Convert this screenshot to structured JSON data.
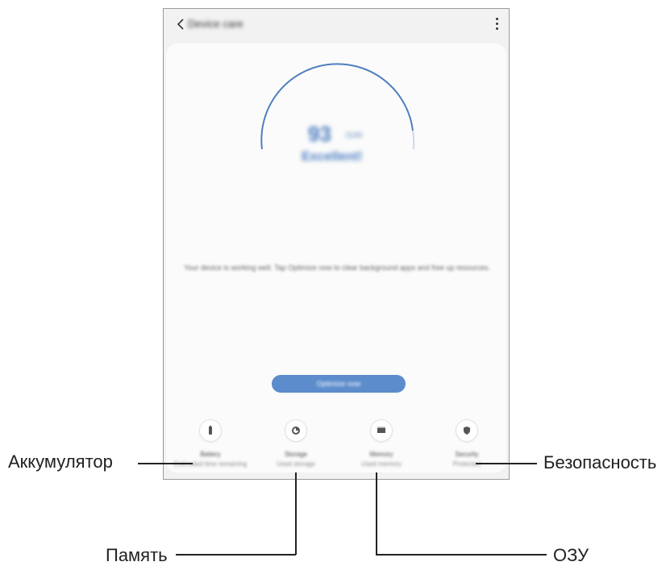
{
  "screen": {
    "title": "Device care",
    "score": "93",
    "score_unit": "/100",
    "status": "Excellent!",
    "description": "Your device is working well. Tap Optimize now to clear background apps and free up resources.",
    "optimize_label": "Optimize now"
  },
  "categories": [
    {
      "icon": "battery-icon",
      "label": "Battery",
      "sub": "Estimated time remaining"
    },
    {
      "icon": "storage-icon",
      "label": "Storage",
      "sub": "Used storage"
    },
    {
      "icon": "memory-icon",
      "label": "Memory",
      "sub": "Used memory"
    },
    {
      "icon": "security-icon",
      "label": "Security",
      "sub": "Protected"
    }
  ],
  "callouts": {
    "battery": "Аккумулятор",
    "security": "Безопасность",
    "storage": "Память",
    "ram": "ОЗУ"
  },
  "colors": {
    "accent": "#5c8ccc",
    "gauge": "#4f7fbf"
  }
}
